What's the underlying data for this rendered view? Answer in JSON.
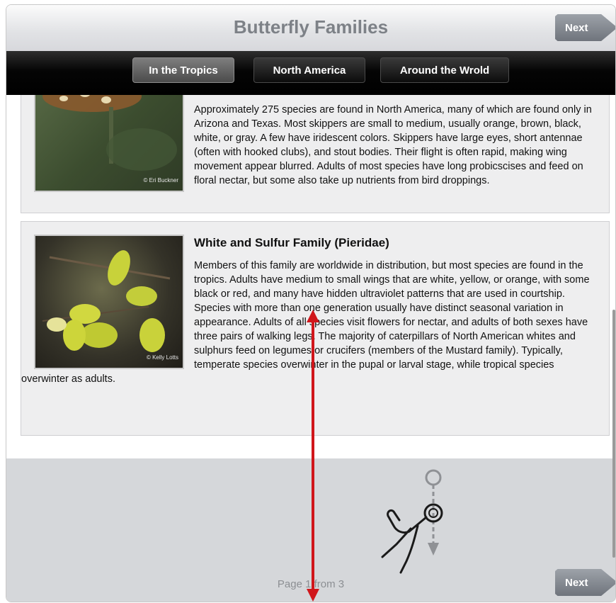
{
  "header": {
    "title": "Butterfly Families",
    "next_label": "Next"
  },
  "tabs": [
    {
      "label": "In the Tropics",
      "active": true
    },
    {
      "label": "North America",
      "active": false
    },
    {
      "label": "Around the Wrold",
      "active": false
    }
  ],
  "cards": [
    {
      "title": "",
      "image_credit": "© Eri Buckner",
      "text": "Approximately 275 species are found in North America, many of which are found only in Arizona and Texas. Most skippers are small to medium, usually orange, brown, black, white, or gray. A few have iridescent colors. Skippers have large eyes, short antennae (often with hooked clubs), and stout bodies. Their flight is often rapid, making wing movement appear blurred. Adults of most species have long probicscises and feed on floral nectar, but some also take up nutrients from bird droppings."
    },
    {
      "title": "White and Sulfur Family (Pieridae)",
      "image_credit": "© Kelly Lotts",
      "text": "Members of this family are worldwide in distribution, but most species are found in the tropics. Adults have medium to small wings that are white, yellow, or orange, with some black or red, and many have hidden ultraviolet patterns that are used in courtship. Species with more than one generation usually have distinct seasonal variation in appearance. Adults of all species visit flowers for nectar, and adults of both sexes have three pairs of walking legs. The majority of caterpillars of North American whites and sulphurs feed on legumes or crucifers (members of the Mustard family). Typically, temperate species overwinter in the pupal or larval stage, while tropical species overwinter as adults."
    }
  ],
  "footer": {
    "page_label": "Page 1 from 3",
    "next_label": "Next"
  },
  "colors": {
    "tabbar": "#000000",
    "annotation_arrow": "#d0161b",
    "footer_bg": "#d5d7da"
  },
  "icons": [
    "swipe-gesture-icon",
    "vertical-arrow-annotation"
  ]
}
